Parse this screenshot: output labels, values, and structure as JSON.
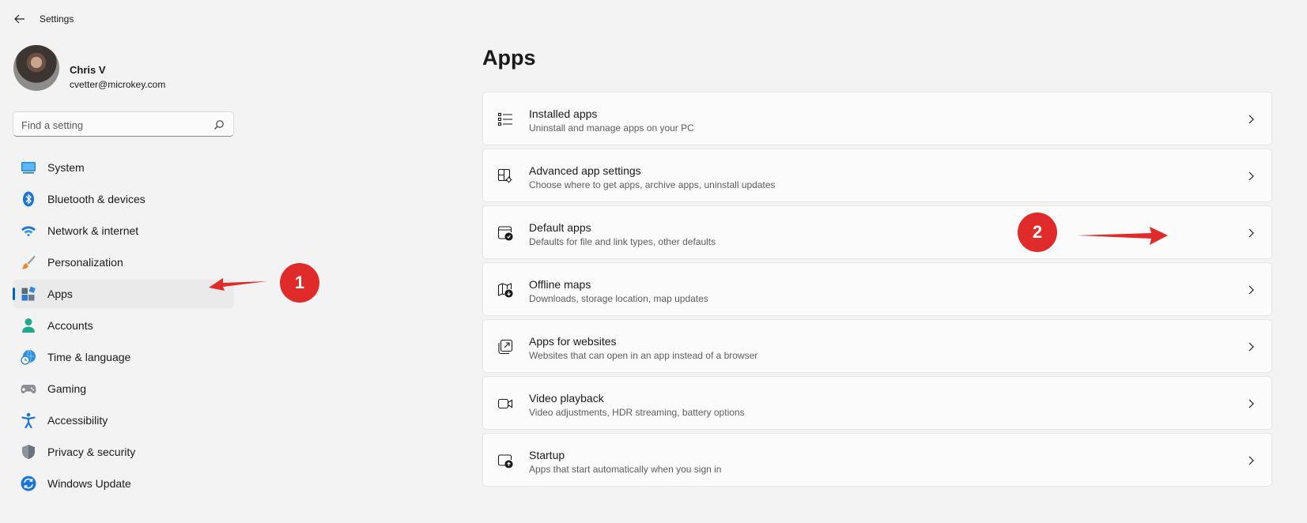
{
  "window": {
    "title": "Settings"
  },
  "profile": {
    "name": "Chris V",
    "email": "cvetter@microkey.com"
  },
  "search": {
    "placeholder": "Find a setting"
  },
  "nav": {
    "items": [
      {
        "label": "System",
        "icon": "system-monitor-icon"
      },
      {
        "label": "Bluetooth & devices",
        "icon": "bluetooth-icon"
      },
      {
        "label": "Network & internet",
        "icon": "wifi-icon"
      },
      {
        "label": "Personalization",
        "icon": "brush-icon"
      },
      {
        "label": "Apps",
        "icon": "apps-icon",
        "selected": true
      },
      {
        "label": "Accounts",
        "icon": "person-icon"
      },
      {
        "label": "Time & language",
        "icon": "globe-clock-icon"
      },
      {
        "label": "Gaming",
        "icon": "gamepad-icon"
      },
      {
        "label": "Accessibility",
        "icon": "accessibility-icon"
      },
      {
        "label": "Privacy & security",
        "icon": "shield-icon"
      },
      {
        "label": "Windows Update",
        "icon": "update-icon"
      }
    ]
  },
  "main": {
    "title": "Apps",
    "cards": [
      {
        "title": "Installed apps",
        "desc": "Uninstall and manage apps on your PC",
        "icon": "list-icon"
      },
      {
        "title": "Advanced app settings",
        "desc": "Choose where to get apps, archive apps, uninstall updates",
        "icon": "app-gear-icon"
      },
      {
        "title": "Default apps",
        "desc": "Defaults for file and link types, other defaults",
        "icon": "app-check-icon"
      },
      {
        "title": "Offline maps",
        "desc": "Downloads, storage location, map updates",
        "icon": "map-download-icon"
      },
      {
        "title": "Apps for websites",
        "desc": "Websites that can open in an app instead of a browser",
        "icon": "open-external-icon"
      },
      {
        "title": "Video playback",
        "desc": "Video adjustments, HDR streaming, battery options",
        "icon": "video-icon"
      },
      {
        "title": "Startup",
        "desc": "Apps that start automatically when you sign in",
        "icon": "startup-icon"
      }
    ]
  },
  "annotations": {
    "step1": "1",
    "step2": "2",
    "color": "#e02b2b"
  },
  "colors": {
    "accent": "#0067c0",
    "background": "#f3f3f3",
    "card": "#fbfbfb"
  }
}
